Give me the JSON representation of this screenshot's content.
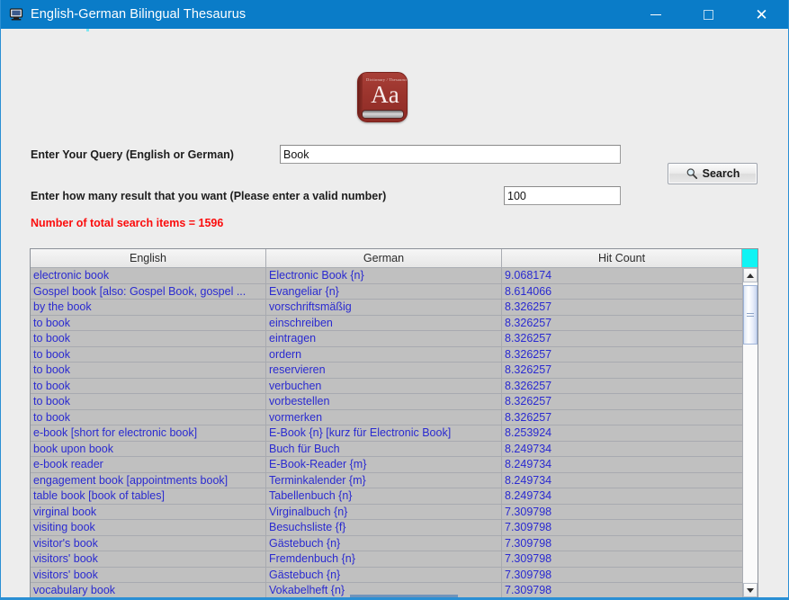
{
  "window": {
    "title": "English-German Bilingual Thesaurus",
    "title_icon": "computer-icon",
    "minimize_label": "",
    "maximize_label": "",
    "close_label": "✕"
  },
  "logo": {
    "icon_name": "dictionary-thesaurus-icon",
    "top_text": "Dictionary / Thesaurus",
    "main_text": "Aa"
  },
  "form": {
    "query_label": "Enter Your Query (English or German)",
    "query_value": "Book",
    "query_placeholder": "",
    "count_label": "Enter how many result that you want (Please enter a valid number)",
    "count_value": "100",
    "count_placeholder": "",
    "search_label": "Search",
    "search_icon": "magnifier-icon"
  },
  "status": {
    "text": "Number of total search items = 1596",
    "color": "#fb0d0d",
    "total_items": 1596
  },
  "table": {
    "columns": [
      "English",
      "German",
      "Hit Count"
    ],
    "corner_color": "#0ff4f4",
    "row_text_color": "#2a2ad0",
    "row_bg_color": "#c0c0c0",
    "rows": [
      [
        "electronic book",
        "Electronic Book {n}",
        "9.068174"
      ],
      [
        "Gospel book [also: Gospel Book, gospel ...",
        "Evangeliar {n}",
        "8.614066"
      ],
      [
        "by the book",
        "vorschriftsmäßig",
        "8.326257"
      ],
      [
        "to book",
        "einschreiben",
        "8.326257"
      ],
      [
        "to book",
        "eintragen",
        "8.326257"
      ],
      [
        "to book",
        "ordern",
        "8.326257"
      ],
      [
        "to book",
        "reservieren",
        "8.326257"
      ],
      [
        "to book",
        "verbuchen",
        "8.326257"
      ],
      [
        "to book",
        "vorbestellen",
        "8.326257"
      ],
      [
        "to book",
        "vormerken",
        "8.326257"
      ],
      [
        "e-book [short for electronic book]",
        "E-Book {n} [kurz für Electronic Book]",
        "8.253924"
      ],
      [
        "book upon book",
        "Buch für Buch",
        "8.249734"
      ],
      [
        "e-book reader",
        "E-Book-Reader {m}",
        "8.249734"
      ],
      [
        "engagement book [appointments book]",
        "Terminkalender {m}",
        "8.249734"
      ],
      [
        "table book [book of tables]",
        "Tabellenbuch {n}",
        "8.249734"
      ],
      [
        "virginal book",
        "Virginalbuch {n}",
        "7.309798"
      ],
      [
        "visiting book",
        "Besuchsliste {f}",
        "7.309798"
      ],
      [
        "visitor's book",
        "Gästebuch {n}",
        "7.309798"
      ],
      [
        "visitors' book",
        "Fremdenbuch {n}",
        "7.309798"
      ],
      [
        "visitors' book",
        "Gästebuch {n}",
        "7.309798"
      ],
      [
        "vocabulary book",
        "Vokabelheft {n}",
        "7.309798"
      ]
    ]
  },
  "scrollbar": {
    "up_icon": "triangle-up-icon",
    "down_icon": "triangle-down-icon",
    "thumb_name": "scrollbar-thumb"
  }
}
